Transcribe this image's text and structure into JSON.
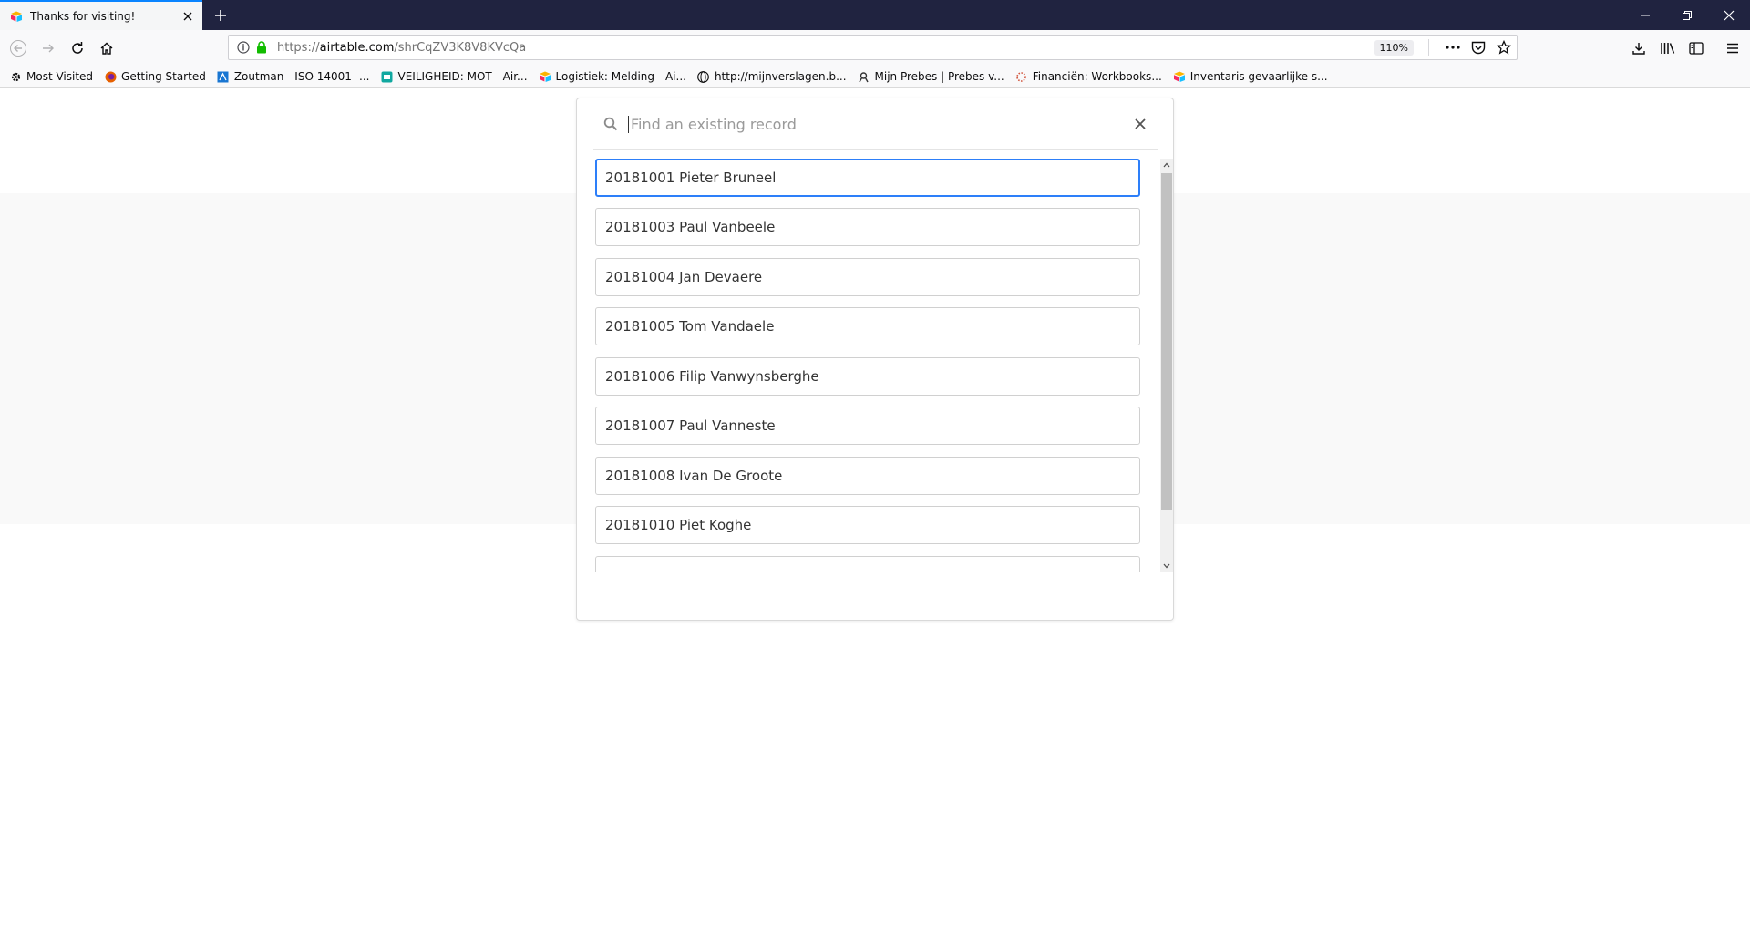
{
  "browser": {
    "tab": {
      "title": "Thanks for visiting!"
    },
    "url": {
      "prefix": "https://",
      "host": "airtable.com",
      "path": "/shrCqZV3K8V8KVcQa"
    },
    "zoom": "110%",
    "bookmarks": [
      {
        "label": "Most Visited",
        "icon": "gear-icon"
      },
      {
        "label": "Getting Started",
        "icon": "firefox-icon"
      },
      {
        "label": "Zoutman - ISO 14001 -...",
        "icon": "site-icon"
      },
      {
        "label": "VEILIGHEID: MOT - Air...",
        "icon": "site-icon"
      },
      {
        "label": "Logistiek: Melding - Ai...",
        "icon": "airtable-icon"
      },
      {
        "label": "http://mijnverslagen.b...",
        "icon": "globe-icon"
      },
      {
        "label": "Mijn Prebes | Prebes v...",
        "icon": "site-icon"
      },
      {
        "label": "Financiën: Workbooks...",
        "icon": "site-icon"
      },
      {
        "label": "Inventaris gevaarlijke s...",
        "icon": "airtable-icon"
      }
    ]
  },
  "dialog": {
    "search": {
      "placeholder": "Find an existing record",
      "value": ""
    },
    "records": [
      {
        "label": "20181001 Pieter Bruneel",
        "selected": true
      },
      {
        "label": "20181003 Paul Vanbeele",
        "selected": false
      },
      {
        "label": "20181004 Jan Devaere",
        "selected": false
      },
      {
        "label": "20181005 Tom Vandaele",
        "selected": false
      },
      {
        "label": "20181006 Filip Vanwynsberghe",
        "selected": false
      },
      {
        "label": "20181007 Paul Vanneste",
        "selected": false
      },
      {
        "label": "20181008 Ivan De Groote",
        "selected": false
      },
      {
        "label": "20181010 Piet Koghe",
        "selected": false
      },
      {
        "label": "",
        "selected": false
      }
    ]
  },
  "colors": {
    "accent": "#2d7ff9",
    "tabstrip": "#202340",
    "lock": "#12bc00"
  }
}
